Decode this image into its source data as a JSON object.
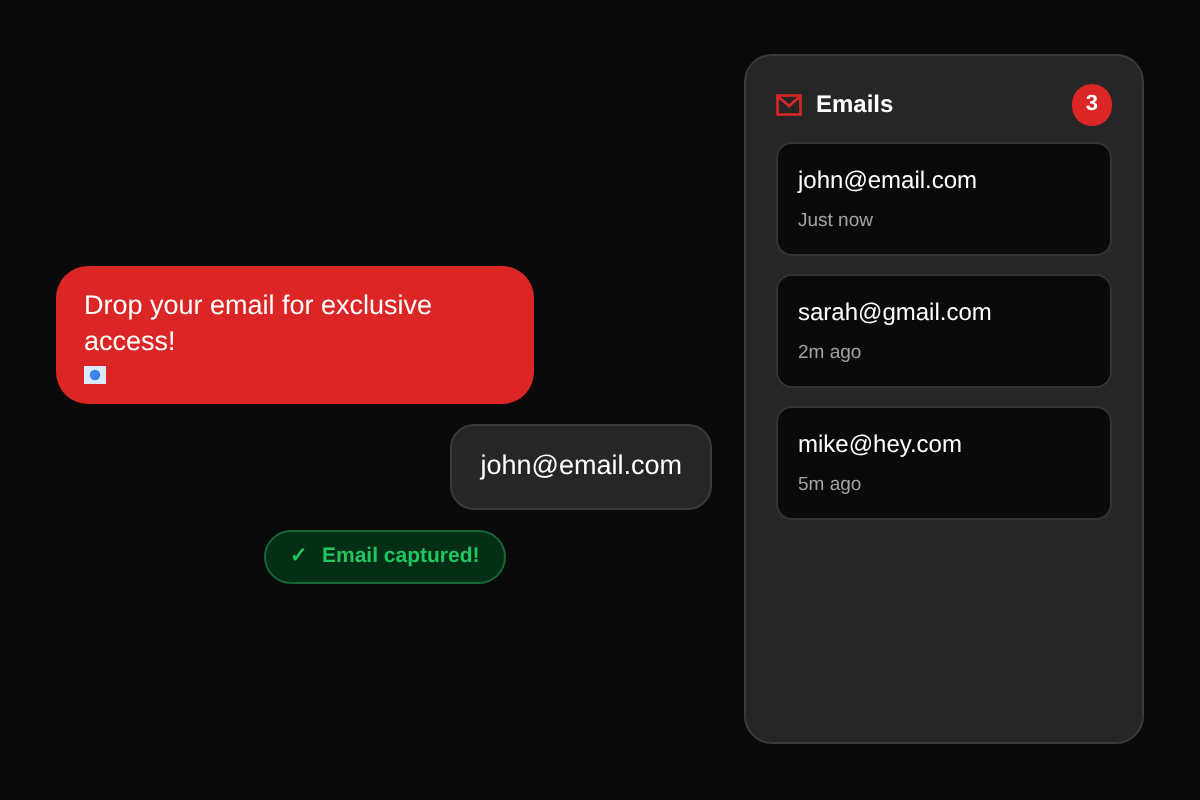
{
  "chat": {
    "prompt": "Drop your email for exclusive access!",
    "reply": "john@email.com",
    "confirmation": {
      "icon": "✓",
      "text": "Email captured!"
    }
  },
  "panel": {
    "title": "Emails",
    "count": "3",
    "items": [
      {
        "email": "john@email.com",
        "time": "Just now"
      },
      {
        "email": "sarah@gmail.com",
        "time": "2m ago"
      },
      {
        "email": "mike@hey.com",
        "time": "5m ago"
      }
    ]
  }
}
